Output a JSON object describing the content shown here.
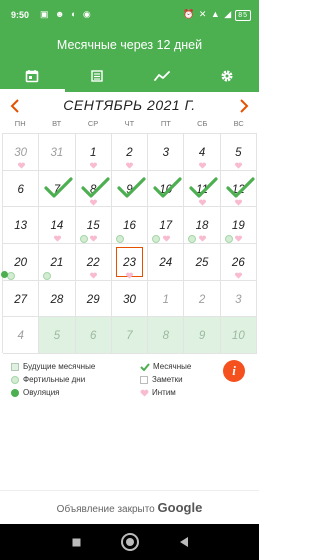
{
  "status_bar": {
    "time": "9:50",
    "battery": "85"
  },
  "header": {
    "title": "Месячные через 12 дней"
  },
  "tabs": [
    {
      "icon": "calendar-icon",
      "active": true
    },
    {
      "icon": "list-icon",
      "active": false
    },
    {
      "icon": "chart-icon",
      "active": false
    },
    {
      "icon": "gear-icon",
      "active": false
    }
  ],
  "calendar": {
    "month_title": "СЕНТЯБРЬ 2021 Г.",
    "weekdays": [
      "ПН",
      "ВТ",
      "СР",
      "ЧТ",
      "ПТ",
      "СБ",
      "ВС"
    ],
    "weeks": [
      [
        {
          "day": "30",
          "other": true,
          "heart": true
        },
        {
          "day": "31",
          "other": true
        },
        {
          "day": "1",
          "heart": true
        },
        {
          "day": "2",
          "heart": true
        },
        {
          "day": "3"
        },
        {
          "day": "4",
          "heart": true
        },
        {
          "day": "5",
          "heart": true
        }
      ],
      [
        {
          "day": "6"
        },
        {
          "day": "7",
          "check": true
        },
        {
          "day": "8",
          "check": true,
          "heart": true
        },
        {
          "day": "9",
          "check": true
        },
        {
          "day": "10",
          "check": true
        },
        {
          "day": "11",
          "check": true,
          "heart": true
        },
        {
          "day": "12",
          "check": true,
          "heart": true
        }
      ],
      [
        {
          "day": "13"
        },
        {
          "day": "14",
          "heart": true
        },
        {
          "day": "15",
          "fertile": true,
          "heart": true
        },
        {
          "day": "16",
          "fertile": true
        },
        {
          "day": "17",
          "fertile": true,
          "heart": true
        },
        {
          "day": "18",
          "fertile": true,
          "heart": true
        },
        {
          "day": "19",
          "fertile": true,
          "heart": true
        }
      ],
      [
        {
          "day": "20",
          "ovulation": true,
          "fertile": true
        },
        {
          "day": "21",
          "fertile": true
        },
        {
          "day": "22",
          "heart": true
        },
        {
          "day": "23",
          "today": true,
          "heart": true
        },
        {
          "day": "24"
        },
        {
          "day": "25"
        },
        {
          "day": "26",
          "heart": true
        }
      ],
      [
        {
          "day": "27"
        },
        {
          "day": "28"
        },
        {
          "day": "29"
        },
        {
          "day": "30"
        },
        {
          "day": "1",
          "other": true
        },
        {
          "day": "2",
          "other": true
        },
        {
          "day": "3",
          "other": true
        }
      ],
      [
        {
          "day": "4",
          "other": true
        },
        {
          "day": "5",
          "other": true,
          "future": true
        },
        {
          "day": "6",
          "other": true,
          "future": true
        },
        {
          "day": "7",
          "other": true,
          "future": true
        },
        {
          "day": "8",
          "other": true,
          "future": true
        },
        {
          "day": "9",
          "other": true,
          "future": true
        },
        {
          "day": "10",
          "other": true,
          "future": true
        }
      ]
    ]
  },
  "legend": {
    "future_periods": "Будущие месячные",
    "periods": "Месячные",
    "fertile_days": "Фертильные дни",
    "notes": "Заметки",
    "ovulation": "Овуляция",
    "intimacy": "Интим"
  },
  "info_button": "i",
  "ad": {
    "text": "Объявление закрыто",
    "brand": "Google"
  },
  "colors": {
    "primary": "#4caf50",
    "accent": "#e65100",
    "heart": "#f06292",
    "future_fill": "#dff2e1"
  }
}
